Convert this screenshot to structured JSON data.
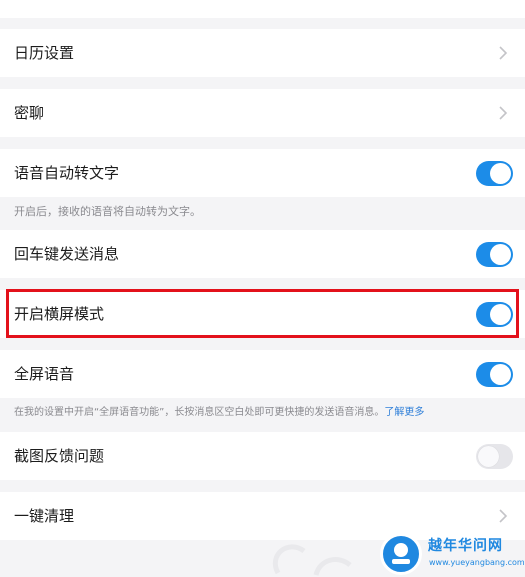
{
  "settings": {
    "calendar": {
      "label": "日历设置"
    },
    "secret_chat": {
      "label": "密聊"
    },
    "voice_to_text": {
      "label": "语音自动转文字",
      "on": true,
      "hint": "开启后，接收的语音将自动转为文字。"
    },
    "enter_send": {
      "label": "回车键发送消息",
      "on": true
    },
    "landscape": {
      "label": "开启横屏模式",
      "on": true
    },
    "fullscreen_voice": {
      "label": "全屏语音",
      "on": true,
      "hint": "在我的设置中开启“全屏语音功能”，长按消息区空白处即可更快捷的发送语音消息。",
      "hint_link": "了解更多"
    },
    "screenshot_feedback": {
      "label": "截图反馈问题",
      "on": false
    },
    "one_click_clean": {
      "label": "一键清理"
    }
  },
  "watermark": {
    "title": "越年华问网",
    "url": "www.yueyangbang.com"
  },
  "colors": {
    "accent": "#1c8ce8",
    "highlight_border": "#e3111b",
    "background": "#f4f4f6"
  }
}
